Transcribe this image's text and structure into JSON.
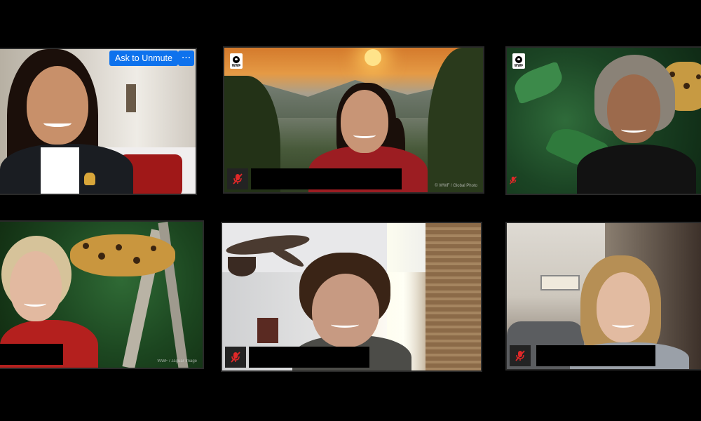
{
  "controls": {
    "ask_to_unmute": "Ask to Unmute",
    "more_options": "···"
  },
  "logos": {
    "wwf_text": "WWF"
  },
  "tiles": [
    {
      "id": "participant-1",
      "name_visible": false,
      "muted": false
    },
    {
      "id": "participant-2",
      "name_visible": false,
      "muted": true,
      "credit": "© WWF / Global Photo"
    },
    {
      "id": "participant-3",
      "name_visible": false,
      "muted": true
    },
    {
      "id": "participant-4",
      "name_visible": false,
      "muted": true,
      "credit": "WWF / Jaguar Image"
    },
    {
      "id": "participant-5",
      "name_visible": false,
      "muted": true
    },
    {
      "id": "participant-6",
      "name_visible": false,
      "muted": true
    }
  ],
  "colors": {
    "background": "#000000",
    "button_blue": "#0e72ed",
    "mute_red": "#e02828",
    "tile_border": "#2a2a2a"
  },
  "icons": [
    "muted-mic-icon",
    "wwf-logo-icon",
    "more-options-icon"
  ]
}
